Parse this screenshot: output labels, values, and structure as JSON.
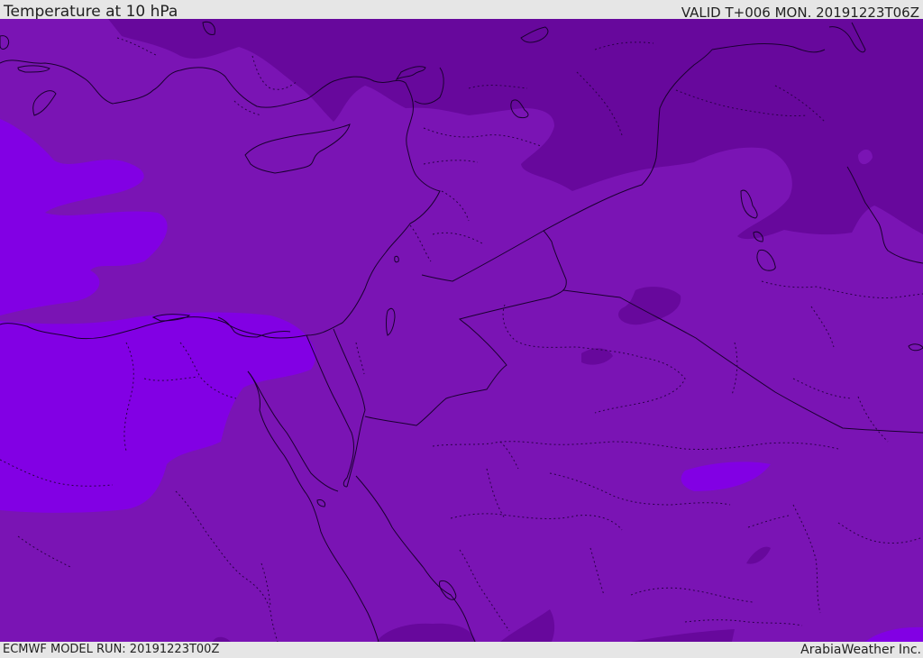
{
  "header": {
    "title": "Temperature at 10 hPa",
    "valid": "VALID T+006 MON. 20191223T06Z"
  },
  "footer": {
    "model_run": "ECMWF MODEL RUN: 20191223T00Z",
    "brand": "ArabiaWeather Inc."
  },
  "colors": {
    "base": "#7a14b4",
    "warm": "#8200e4",
    "cold": "#67089c",
    "coastline": "#1a0030"
  }
}
